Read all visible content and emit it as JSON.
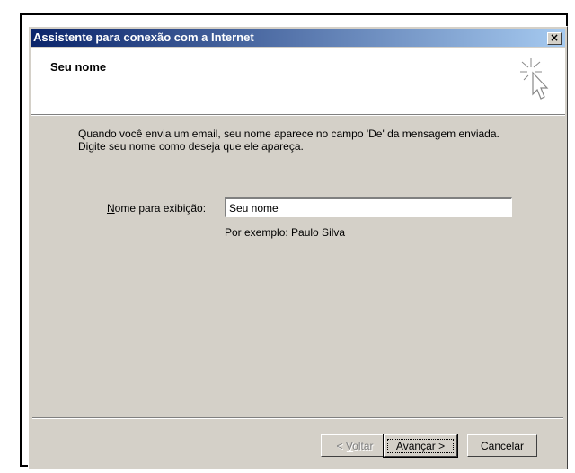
{
  "window": {
    "title": "Assistente para conexão com a Internet",
    "close_symbol": "×"
  },
  "header": {
    "title": "Seu nome",
    "icon": "wizard-sparkle-cursor-icon"
  },
  "content": {
    "description": "Quando você envia um email, seu nome aparece no campo 'De' da mensagem enviada. Digite seu nome como deseja que ele apareça.",
    "field_label_mnemonic": "N",
    "field_label_rest": "ome para exibição:",
    "field_value": "Seu nome",
    "example": "Por exemplo: Paulo Silva"
  },
  "buttons": {
    "back_prefix": "< ",
    "back_mnemonic": "V",
    "back_rest": "oltar",
    "next_mnemonic": "A",
    "next_rest": "vançar >",
    "cancel": "Cancelar"
  }
}
